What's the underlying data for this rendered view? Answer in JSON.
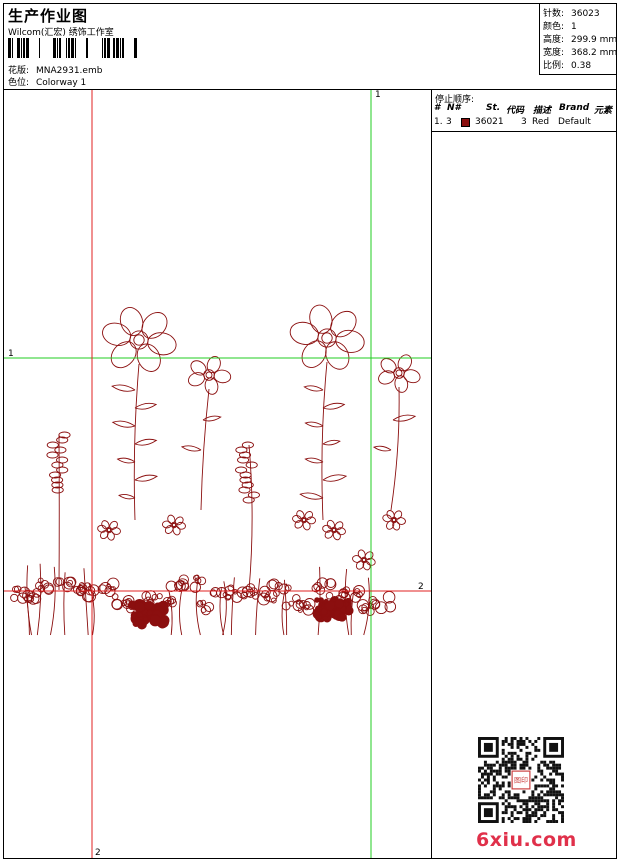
{
  "header": {
    "title": "生产作业图",
    "company": "Wilcom(汇宏) 绣饰工作室",
    "design_label": "花版:",
    "design_value": "MNA2931.emb",
    "colorway_label": "色位:",
    "colorway_value": "Colorway 1"
  },
  "stats": [
    {
      "label": "针数:",
      "value": "36023"
    },
    {
      "label": "颜色:",
      "value": "1"
    },
    {
      "label": "高度:",
      "value": "299.9 mm"
    },
    {
      "label": "宽度:",
      "value": "368.2 mm"
    },
    {
      "label": "比例:",
      "value": "0.38"
    }
  ],
  "stop_sequence": {
    "title": "停止顺序:",
    "columns": [
      "#",
      "N#",
      "St.",
      "代码",
      "描述",
      "Brand",
      "元素"
    ],
    "rows": [
      {
        "index": "1.",
        "needle": "3",
        "color": "#8b0f0f",
        "stitches": "36021",
        "code": "3",
        "description": "Red",
        "brand": "Default",
        "element": ""
      }
    ]
  },
  "guides": {
    "green_v_top": "1",
    "green_h_left": "1",
    "red_h_right": "2",
    "red_v_bottom": "2"
  },
  "design_color": "#8b0f0f",
  "watermark": {
    "site": "6xiu.com",
    "seal": "图印"
  }
}
